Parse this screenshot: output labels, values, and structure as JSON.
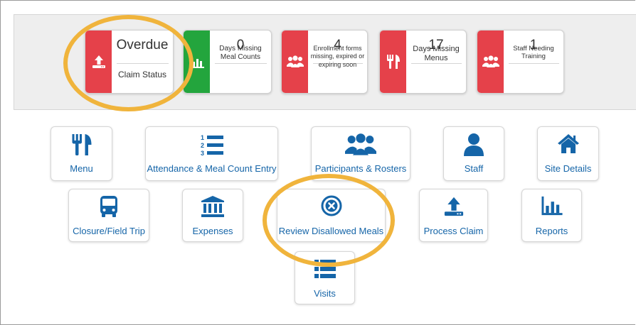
{
  "status_cards": [
    {
      "value": "Overdue",
      "label": "Claim Status",
      "color": "#e5414a",
      "icon": "upload-tray-icon"
    },
    {
      "value": "0",
      "label": "Days Missing Meal Counts",
      "color": "#23a53d",
      "icon": "bar-chart-icon"
    },
    {
      "value": "4",
      "label": "Enrollment forms missing, expired or expiring soon",
      "color": "#e5414a",
      "icon": "users-icon"
    },
    {
      "value": "17",
      "label": "Days Missing Menus",
      "color": "#e5414a",
      "icon": "fork-knife-icon"
    },
    {
      "value": "1",
      "label": "Staff Needing Training",
      "color": "#e5414a",
      "icon": "users-icon"
    }
  ],
  "nav_tiles": [
    {
      "label": "Menu",
      "icon": "fork-knife-icon"
    },
    {
      "label": "Attendance & Meal Count Entry",
      "icon": "numbered-list-icon"
    },
    {
      "label": "Participants & Rosters",
      "icon": "users-icon"
    },
    {
      "label": "Staff",
      "icon": "user-icon"
    },
    {
      "label": "Site Details",
      "icon": "home-icon"
    },
    {
      "label": "Closure/Field Trip",
      "icon": "bus-icon"
    },
    {
      "label": "Expenses",
      "icon": "bank-icon"
    },
    {
      "label": "Review Disallowed Meals",
      "icon": "circle-x-icon"
    },
    {
      "label": "Process Claim",
      "icon": "upload-tray-icon"
    },
    {
      "label": "Reports",
      "icon": "bar-chart-icon"
    },
    {
      "label": "Visits",
      "icon": "list-icon"
    }
  ],
  "colors": {
    "accent": "#1565a8",
    "alert": "#e5414a",
    "ok": "#23a53d",
    "highlight_ring": "#f0b43c"
  }
}
